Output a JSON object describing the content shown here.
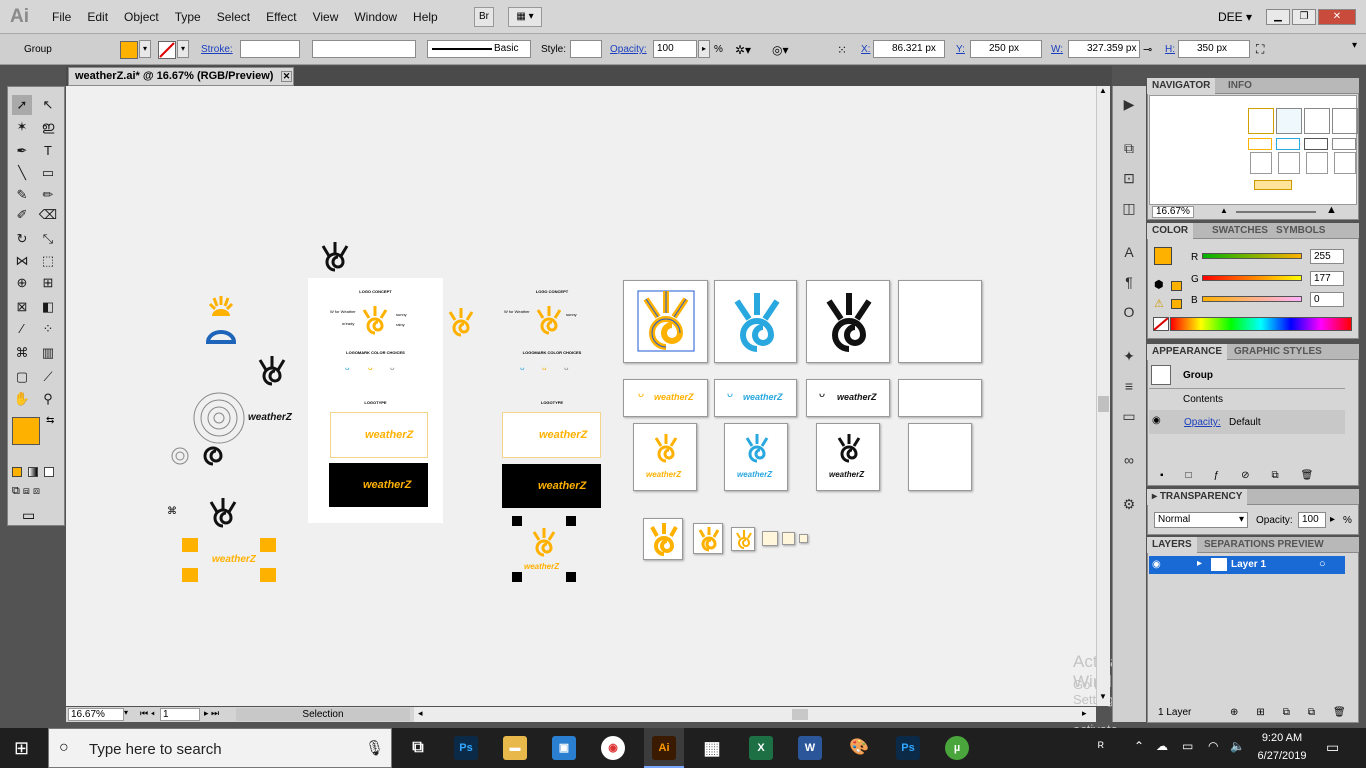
{
  "app": {
    "logo": "Ai",
    "menus": [
      "File",
      "Edit",
      "Object",
      "Type",
      "Select",
      "Effect",
      "View",
      "Window",
      "Help"
    ],
    "bridge_btn": "Br",
    "workspace": "DEE"
  },
  "control": {
    "selection_type": "Group",
    "stroke_label": "Stroke:",
    "brush_label": "Basic",
    "style_label": "Style:",
    "opacity_label": "Opacity:",
    "opacity_value": "100",
    "opacity_unit": "%",
    "x_label": "X:",
    "x_value": "86.321 px",
    "y_label": "Y:",
    "y_value": "250 px",
    "w_label": "W:",
    "w_value": "327.359 px",
    "h_label": "H:",
    "h_value": "350 px"
  },
  "document": {
    "tab_title": "weatherZ.ai* @ 16.67% (RGB/Preview)",
    "close": "✕"
  },
  "status": {
    "zoom": "16.67%",
    "page": "1",
    "tool": "Selection"
  },
  "artwork": {
    "brand": "weatherZ",
    "concept_title": "LOGO CONCEPT",
    "color_choices_title": "LOGOMARK COLOR CHOICES",
    "logotype_title": "LOGOTYPE",
    "concept_line1": "W for Weather",
    "concept_line2": "w'eady",
    "concept_right1": "sunny",
    "concept_right2": "rainy"
  },
  "navigator": {
    "tabs": [
      "NAVIGATOR",
      "INFO"
    ],
    "zoom": "16.67%"
  },
  "color_panel": {
    "tabs": [
      "COLOR",
      "SWATCHES",
      "SYMBOLS"
    ],
    "r_label": "R",
    "g_label": "G",
    "b_label": "B",
    "r": "255",
    "g": "177",
    "b": "0",
    "fill": "#ffb100"
  },
  "appearance": {
    "tabs": [
      "APPEARANCE",
      "GRAPHIC STYLES"
    ],
    "group": "Group",
    "contents": "Contents",
    "opacity_label": "Opacity:",
    "opacity_value": "Default"
  },
  "transparency": {
    "tab": "TRANSPARENCY",
    "mode": "Normal",
    "opacity_label": "Opacity:",
    "opacity_value": "100",
    "unit": "%"
  },
  "layers": {
    "tabs": [
      "LAYERS",
      "SEPARATIONS PREVIEW"
    ],
    "layer_name": "Layer 1",
    "footer": "1 Layer"
  },
  "watermark": {
    "line1": "Activate Windows",
    "line2": "Go to Settings to activate Windows."
  },
  "taskbar": {
    "search_placeholder": "Type here to search",
    "time": "9:20 AM",
    "date": "6/27/2019"
  },
  "colors": {
    "brand_orange": "#ffb100",
    "brand_blue": "#29a8e0",
    "brand_black": "#111111",
    "selection_blue": "#1e5ad6"
  }
}
